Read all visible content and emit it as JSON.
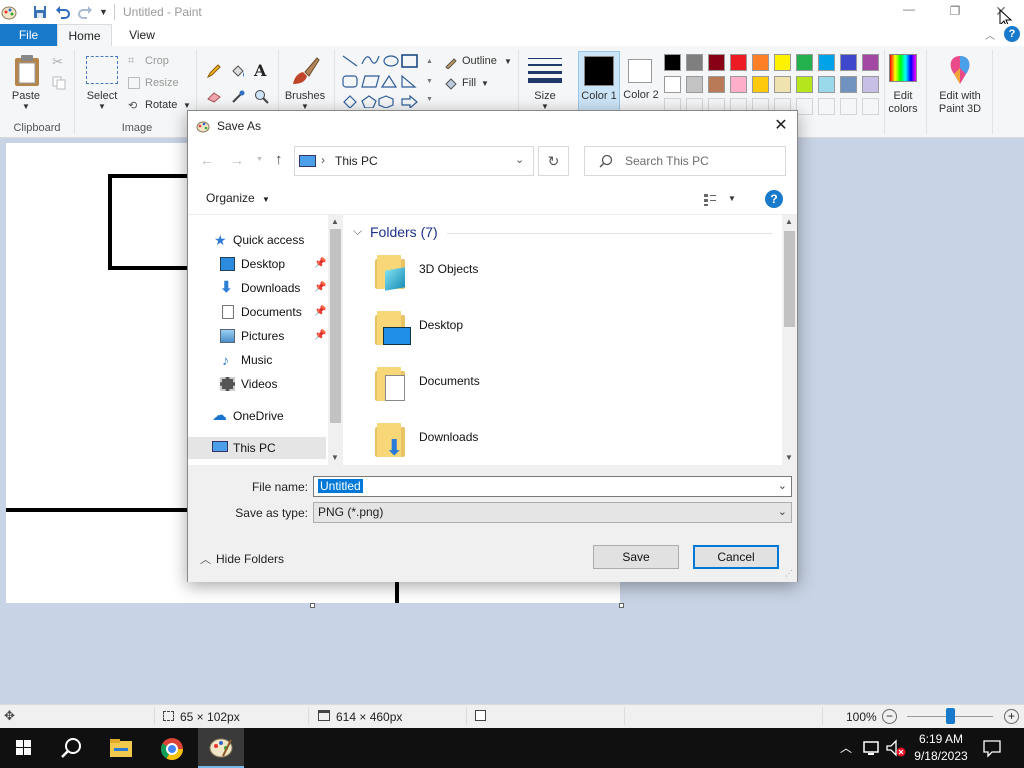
{
  "app": {
    "title": "Untitled - Paint",
    "tabs": [
      "File",
      "Home",
      "View"
    ],
    "accent": "#1979ca"
  },
  "ribbon": {
    "clipboard": {
      "paste": "Paste",
      "group": "Clipboard"
    },
    "image": {
      "select": "Select",
      "crop": "Crop",
      "resize": "Resize",
      "rotate": "Rotate",
      "group": "Image"
    },
    "tools": {
      "brushes": "Brushes"
    },
    "shapes": {
      "outline": "Outline",
      "fill": "Fill"
    },
    "size": "Size",
    "color1": "Color 1",
    "color2": "Color 2",
    "edit_colors": "Edit colors",
    "edit_paint3d": "Edit with Paint 3D",
    "palette_row1": [
      "#000000",
      "#7f7f7f",
      "#880015",
      "#ed1c24",
      "#ff7f27",
      "#fff200",
      "#22b14c",
      "#00a2e8",
      "#3f48cc",
      "#a349a4"
    ],
    "palette_row2": [
      "#ffffff",
      "#c3c3c3",
      "#b97a57",
      "#ffaec9",
      "#ffc90e",
      "#efe4b0",
      "#b5e61d",
      "#99d9ea",
      "#7092be",
      "#c8bfe7"
    ]
  },
  "dialog": {
    "title": "Save As",
    "address": "This PC",
    "search_placeholder": "Search This PC",
    "organize": "Organize",
    "folders_header": "Folders (7)",
    "nav_items": [
      {
        "label": "Quick access",
        "icon": "star-icon",
        "pinned": false
      },
      {
        "label": "Desktop",
        "icon": "desktop-icon",
        "pinned": true
      },
      {
        "label": "Downloads",
        "icon": "download-icon",
        "pinned": true
      },
      {
        "label": "Documents",
        "icon": "document-icon",
        "pinned": true
      },
      {
        "label": "Pictures",
        "icon": "pictures-icon",
        "pinned": true
      },
      {
        "label": "Music",
        "icon": "music-icon",
        "pinned": false
      },
      {
        "label": "Videos",
        "icon": "video-icon",
        "pinned": false
      },
      {
        "label": "OneDrive",
        "icon": "cloud-icon",
        "pinned": false
      },
      {
        "label": "This PC",
        "icon": "pc-icon",
        "pinned": false
      }
    ],
    "folders": [
      "3D Objects",
      "Desktop",
      "Documents",
      "Downloads"
    ],
    "file_name_label": "File name:",
    "file_name_value": "Untitled",
    "save_type_label": "Save as type:",
    "save_type_value": "PNG (*.png)",
    "hide_folders": "Hide Folders",
    "save_button": "Save",
    "cancel_button": "Cancel"
  },
  "status": {
    "selection_size": "65 × 102px",
    "canvas_size": "614 × 460px",
    "zoom": "100%"
  },
  "taskbar": {
    "time": "6:19 AM",
    "date": "9/18/2023"
  }
}
